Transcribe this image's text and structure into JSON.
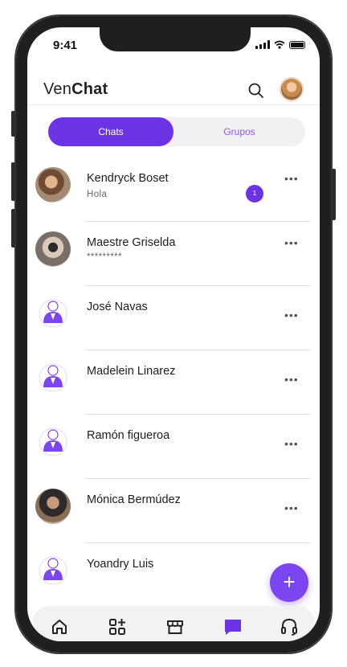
{
  "status_bar": {
    "time": "9:41"
  },
  "header": {
    "brand_prefix": "Ven",
    "brand_bold": "Chat"
  },
  "tabs": [
    {
      "label": "Chats",
      "active": true
    },
    {
      "label": "Grupos",
      "active": false
    }
  ],
  "chats": [
    {
      "name": "Kendryck Boset",
      "preview": "Hola",
      "unread": "1",
      "avatar": "photo"
    },
    {
      "name": "Maestre Griselda",
      "preview": "*********",
      "avatar": "photo"
    },
    {
      "name": "José Navas",
      "preview": "",
      "avatar": "default-user-icon"
    },
    {
      "name": "Madelein Linarez",
      "preview": "",
      "avatar": "default-user-icon"
    },
    {
      "name": "Ramón figueroa",
      "preview": "",
      "avatar": "default-user-icon"
    },
    {
      "name": "Mónica Bermúdez",
      "preview": "",
      "avatar": "photo"
    },
    {
      "name": "Yoandry Luis",
      "preview": "",
      "avatar": "default-user-icon"
    }
  ],
  "fab": {
    "label": "+"
  },
  "bottom_nav": [
    "home-icon",
    "apps-add-icon",
    "store-icon",
    "chat-icon",
    "headset-icon"
  ],
  "colors": {
    "accent": "#6b33e3",
    "tab_inactive_text": "#8a5ae6"
  }
}
